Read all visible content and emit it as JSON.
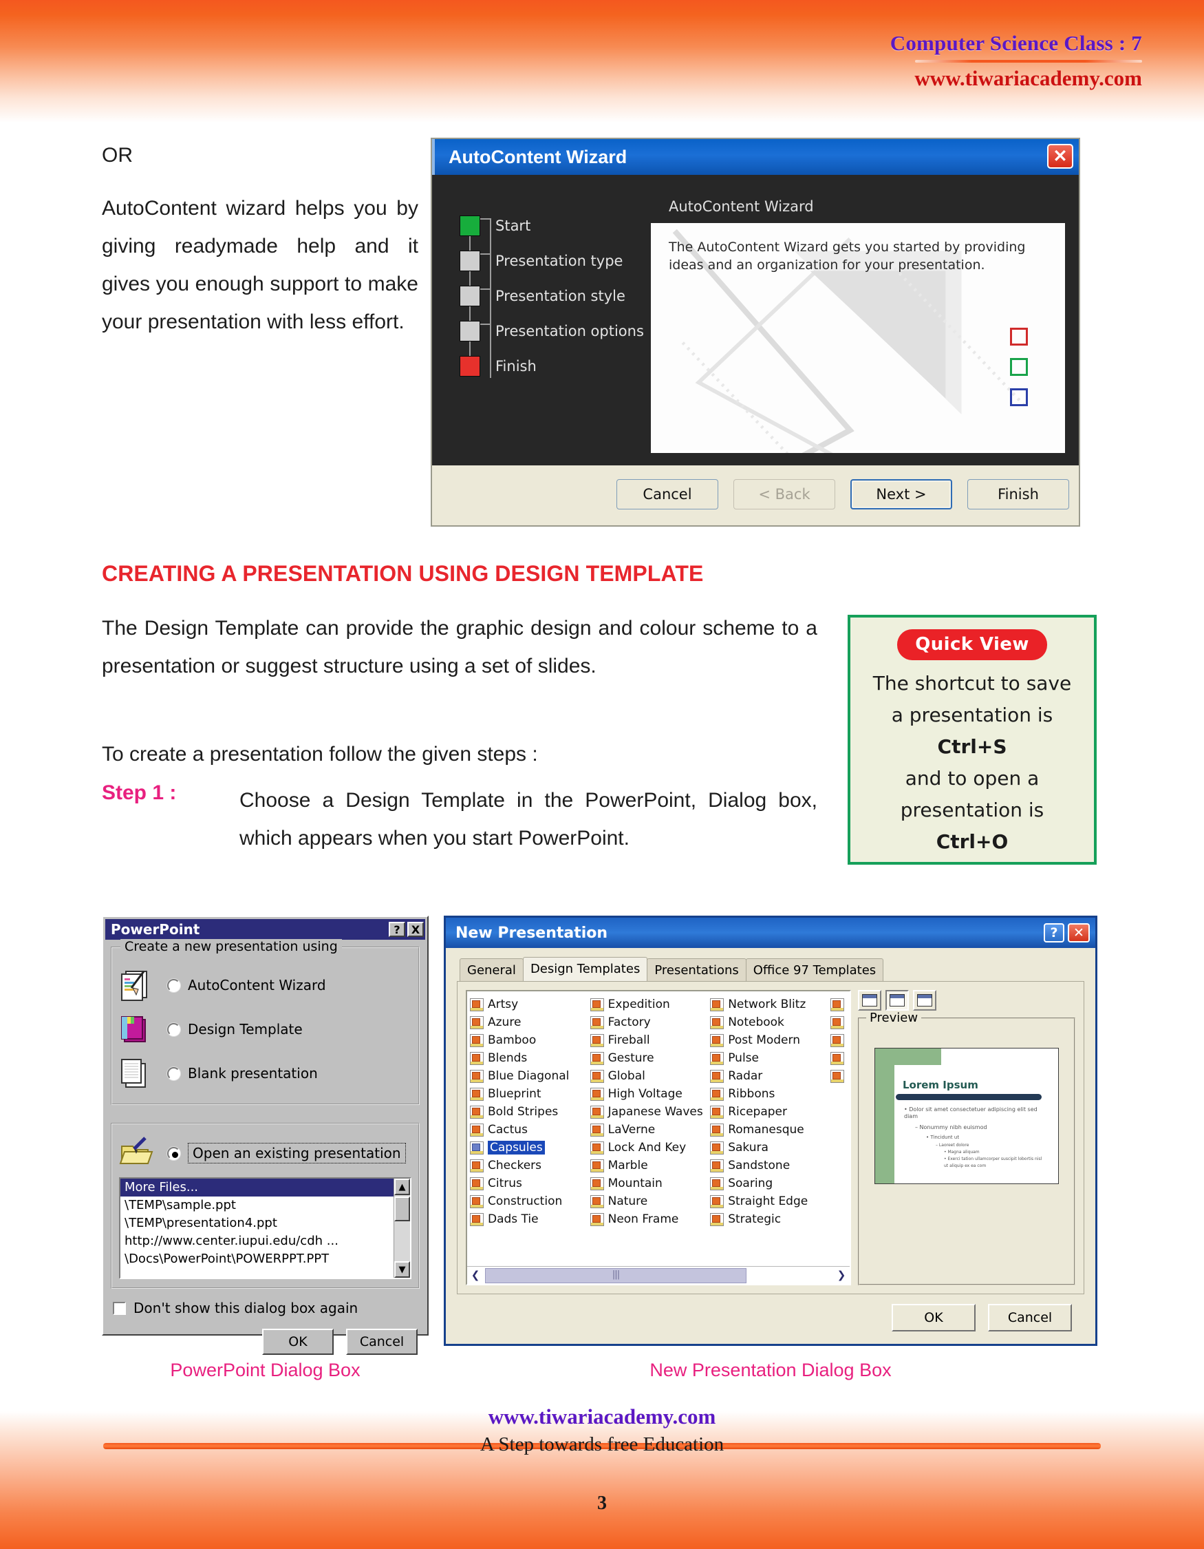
{
  "header": {
    "title": "Computer Science Class : 7",
    "site": "www.tiwariacademy.com"
  },
  "left_column": {
    "or": "OR",
    "paragraph": "AutoContent wizard helps you by giving readymade help and it gives you enough support to make your presentation with less effort."
  },
  "section": {
    "heading": "CREATING A PRESENTATION USING DESIGN TEMPLATE",
    "para1": "The Design Template can provide the graphic design and colour scheme to a presentation  or suggest structure using a set of slides.",
    "para2": "To create a presentation follow the given steps :",
    "step1_label": "Step 1 :",
    "step1_text": "Choose a Design Template in the PowerPoint, Dialog box, which appears when you start PowerPoint."
  },
  "quick_view": {
    "badge": "Quick View",
    "line1": "The shortcut to save",
    "line2": "a presentation is",
    "key1": "Ctrl+S",
    "line3": "and to open a",
    "line4": "presentation is",
    "key2": "Ctrl+O",
    "border_color": "#16a05a",
    "badge_color": "#ea2227",
    "bg_color": "#eef0dd"
  },
  "autocontent_wizard": {
    "title": "AutoContent Wizard",
    "close_icon": "✕",
    "steps": [
      {
        "label": "Start",
        "state": "green"
      },
      {
        "label": "Presentation type",
        "state": "grey"
      },
      {
        "label": "Presentation style",
        "state": "grey"
      },
      {
        "label": "Presentation options",
        "state": "grey"
      },
      {
        "label": "Finish",
        "state": "red"
      }
    ],
    "pane_subtitle": "AutoContent Wizard",
    "pane_text": "The AutoContent Wizard gets you started by providing ideas and an organization for your presentation.",
    "buttons": [
      {
        "label": "Cancel",
        "style": "normal"
      },
      {
        "label": "< Back",
        "style": "disabled"
      },
      {
        "label": "Next >",
        "style": "default"
      },
      {
        "label": "Finish",
        "style": "normal"
      }
    ]
  },
  "powerpoint_dialog": {
    "title": "PowerPoint",
    "help_icon": "?",
    "close_icon": "X",
    "group1_label": "Create a new presentation using",
    "options": [
      {
        "label": "AutoContent Wizard",
        "selected": false,
        "icon": "autocontent-wizard-icon"
      },
      {
        "label": "Design Template",
        "selected": false,
        "icon": "design-template-icon"
      },
      {
        "label": "Blank presentation",
        "selected": false,
        "icon": "blank-presentation-icon"
      }
    ],
    "open_existing_label": "Open an existing presentation",
    "open_existing_selected": true,
    "files": [
      "More Files...",
      "\\TEMP\\sample.ppt",
      "\\TEMP\\presentation4.ppt",
      "http://www.center.iupui.edu/cdh ...",
      "\\Docs\\PowerPoint\\POWERPPT.PPT"
    ],
    "selected_file_index": 0,
    "dont_show_label": "Don't show this dialog box again",
    "dont_show_checked": false,
    "ok_label": "OK",
    "cancel_label": "Cancel",
    "caption": "PowerPoint Dialog Box"
  },
  "new_presentation_dialog": {
    "title": "New Presentation",
    "help_icon": "?",
    "close_icon": "✕",
    "tabs": [
      {
        "label": "General",
        "active": false
      },
      {
        "label": "Design Templates",
        "active": true
      },
      {
        "label": "Presentations",
        "active": false
      },
      {
        "label": "Office 97 Templates",
        "active": false
      }
    ],
    "template_columns": [
      [
        "Artsy",
        "Azure",
        "Bamboo",
        "Blends",
        "Blue Diagonal",
        "Blueprint",
        "Bold Stripes",
        "Cactus",
        "Capsules",
        "Checkers",
        "Citrus",
        "Construction",
        "Dads Tie"
      ],
      [
        "Expedition",
        "Factory",
        "Fireball",
        "Gesture",
        "Global",
        "High Voltage",
        "Japanese Waves",
        "LaVerne",
        "Lock And Key",
        "Marble",
        "Mountain",
        "Nature",
        "Neon Frame"
      ],
      [
        "Network Blitz",
        "Notebook",
        "Post Modern",
        "Pulse",
        "Radar",
        "Ribbons",
        "Ricepaper",
        "Romanesque",
        "Sakura",
        "Sandstone",
        "Soaring",
        "Straight Edge",
        "Strategic"
      ]
    ],
    "selected_template": "Capsules",
    "view_buttons": [
      "list-view-icon",
      "details-view-icon",
      "large-icons-view-icon"
    ],
    "preview_label": "Preview",
    "preview_slide": {
      "title": "Lorem Ipsum",
      "bullet1": "Dolor sit amet consectetuer adipiscing elit sed diam",
      "bullet2": "Nonummy nibh euismod",
      "bullet3": "Tincidunt ut",
      "bullet4": "Laoreet dolore",
      "bullet5": "Magna aliquam",
      "bullet6": "Exerci tation ullamcorper suscipit lobortis nisl ut aliquip ex ea com"
    },
    "ok_label": "OK",
    "cancel_label": "Cancel",
    "caption": "New Presentation Dialog Box"
  },
  "footer": {
    "site": "www.tiwariacademy.com",
    "tagline": "A Step towards free Education",
    "page_number": "3"
  }
}
